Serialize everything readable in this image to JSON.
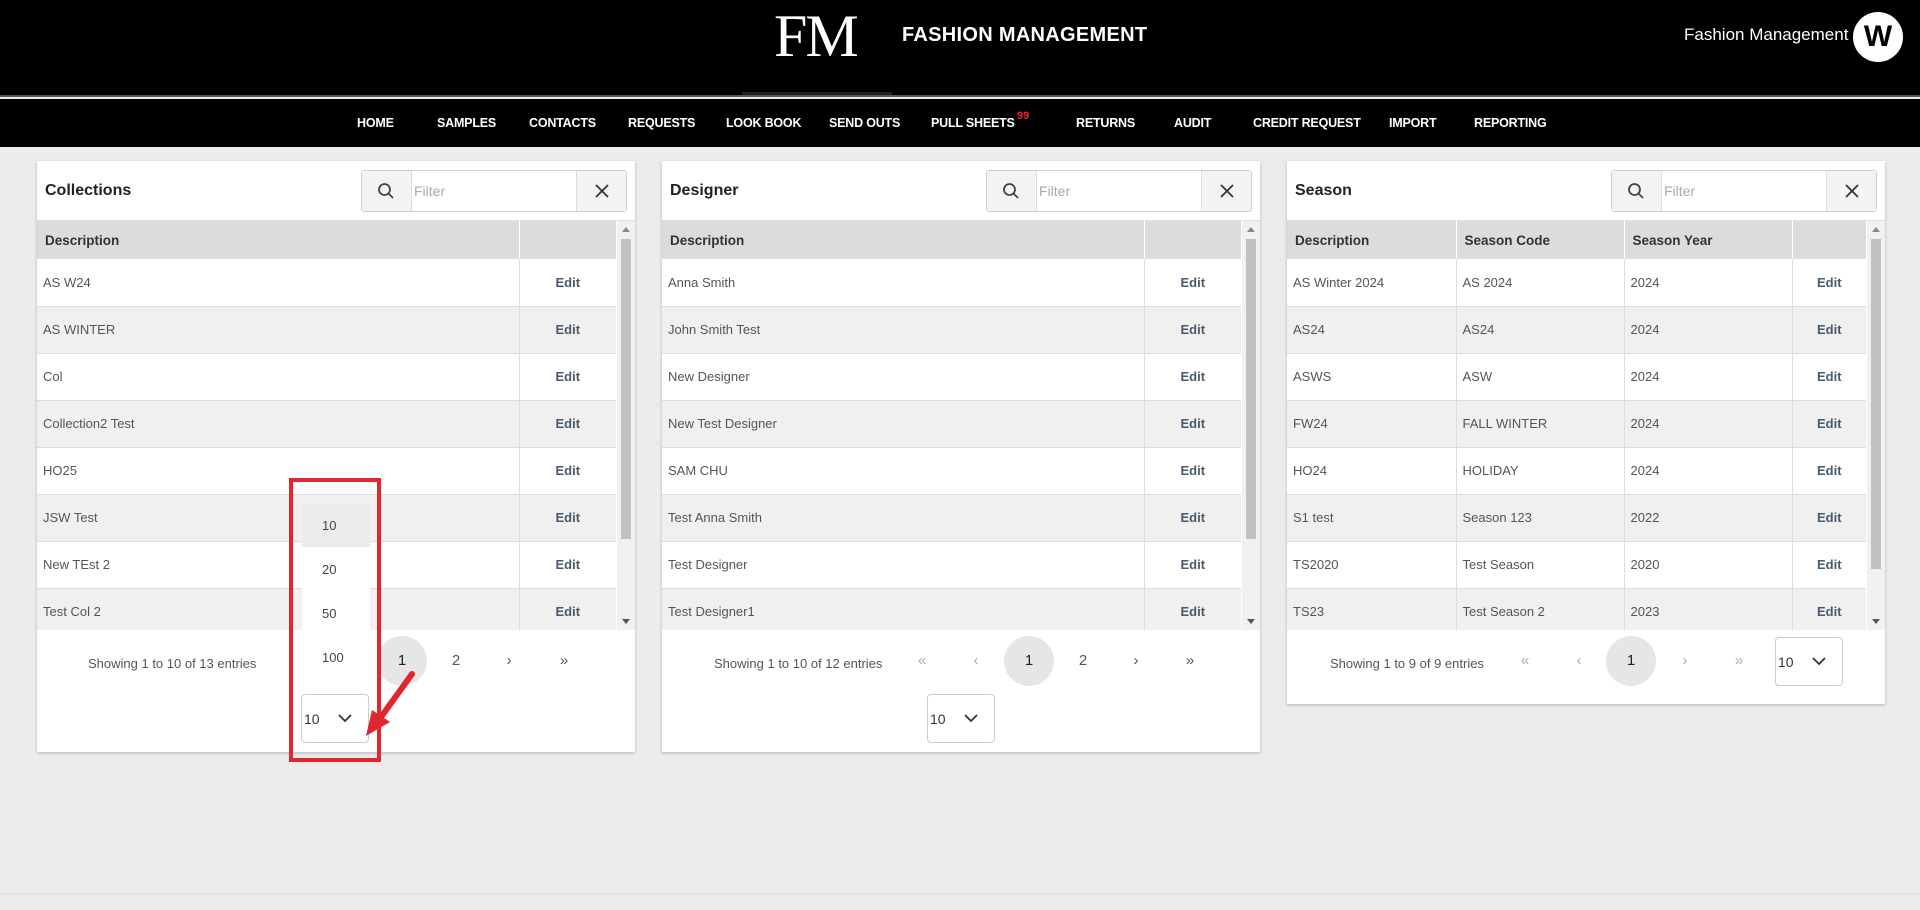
{
  "header": {
    "logo_text": "FM",
    "brand_title": "FASHION MANAGEMENT",
    "user_name": "Fashion Management",
    "avatar_letter": "W"
  },
  "nav": {
    "items": [
      {
        "label": "HOME"
      },
      {
        "label": "SAMPLES"
      },
      {
        "label": "CONTACTS"
      },
      {
        "label": "REQUESTS"
      },
      {
        "label": "LOOK BOOK"
      },
      {
        "label": "SEND OUTS"
      },
      {
        "label": "PULL SHEETS",
        "badge": "99"
      },
      {
        "label": "RETURNS"
      },
      {
        "label": "AUDIT"
      },
      {
        "label": "CREDIT REQUEST"
      },
      {
        "label": "IMPORT"
      },
      {
        "label": "REPORTING"
      }
    ]
  },
  "filter_placeholder": "Filter",
  "edit_label": "Edit",
  "collections": {
    "title": "Collections",
    "columns": [
      "Description",
      ""
    ],
    "rows": [
      [
        "AS W24"
      ],
      [
        "AS WINTER"
      ],
      [
        "Col"
      ],
      [
        "Collection2 Test"
      ],
      [
        "HO25"
      ],
      [
        "JSW Test"
      ],
      [
        "New TEst 2"
      ],
      [
        "Test Col 2"
      ]
    ],
    "showing": "Showing 1 to 10 of 13 entries",
    "pages": [
      "1",
      "2"
    ],
    "page_size": "10"
  },
  "designer": {
    "title": "Designer",
    "columns": [
      "Description",
      ""
    ],
    "rows": [
      [
        "Anna Smith"
      ],
      [
        "John Smith Test"
      ],
      [
        "New Designer"
      ],
      [
        "New Test Designer"
      ],
      [
        "SAM CHU"
      ],
      [
        "Test Anna Smith"
      ],
      [
        "Test Designer"
      ],
      [
        "Test Designer1"
      ]
    ],
    "showing": "Showing 1 to 10 of 12 entries",
    "pages": [
      "1",
      "2"
    ],
    "page_size": "10"
  },
  "season": {
    "title": "Season",
    "columns": [
      "Description",
      "Season Code",
      "Season Year",
      ""
    ],
    "rows": [
      [
        "AS Winter 2024",
        "AS 2024",
        "2024"
      ],
      [
        "AS24",
        "AS24",
        "2024"
      ],
      [
        "ASWS",
        "ASW",
        "2024"
      ],
      [
        "FW24",
        "FALL WINTER",
        "2024"
      ],
      [
        "HO24",
        "HOLIDAY",
        "2024"
      ],
      [
        "S1 test",
        "Season 123",
        "2022"
      ],
      [
        "TS2020",
        "Test Season",
        "2020"
      ],
      [
        "TS23",
        "Test Season 2",
        "2023"
      ]
    ],
    "showing": "Showing 1 to 9 of 9 entries",
    "pages": [
      "1"
    ],
    "page_size": "10"
  },
  "pager_icons": {
    "first": "«",
    "prev": "‹",
    "next": "›",
    "last": "»"
  },
  "page_size_dropdown": {
    "options": [
      "10",
      "20",
      "50",
      "100"
    ],
    "selected": "10"
  },
  "colors": {
    "accent_red": "#e0262f",
    "header_bg": "#000000",
    "edit_link": "#4a5a6e"
  }
}
